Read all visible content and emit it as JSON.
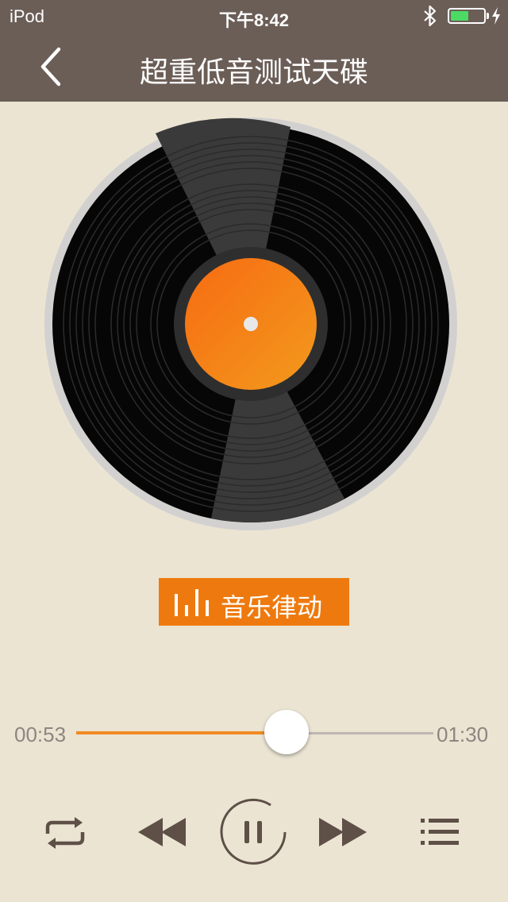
{
  "status_bar": {
    "carrier": "iPod",
    "time": "下午8:42",
    "bluetooth_icon": "bluetooth-icon",
    "battery_icon": "battery-icon",
    "battery_level": 0.55,
    "charging_icon": "charging-icon"
  },
  "nav": {
    "back_icon": "chevron-left-icon",
    "title": "超重低音测试天碟"
  },
  "album_art": {
    "icon": "vinyl-record-icon",
    "label_color": "#f28a16"
  },
  "rhythm_button": {
    "icon": "equalizer-icon",
    "label": "音乐律动"
  },
  "progress": {
    "current_time": "00:53",
    "total_time": "01:30",
    "fraction": 0.589
  },
  "controls": {
    "repeat_icon": "repeat-icon",
    "previous_icon": "rewind-icon",
    "play_pause_icon": "pause-icon",
    "next_icon": "fast-forward-icon",
    "playlist_icon": "playlist-icon"
  },
  "colors": {
    "bar": "#6b5e57",
    "background": "#ebe4d3",
    "accent": "#ee7a0f",
    "control": "#5e4f47"
  }
}
